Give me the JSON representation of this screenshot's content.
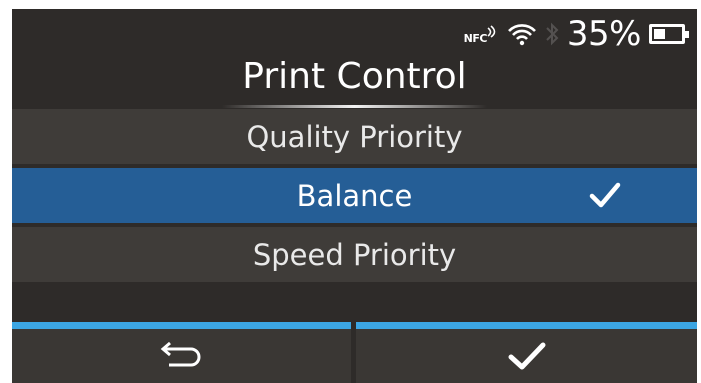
{
  "status_bar": {
    "nfc_label": "NFC",
    "wifi_icon": "wifi-icon",
    "bluetooth_icon": "bluetooth-icon",
    "battery_percent": "35%",
    "battery_level": 0.35
  },
  "screen": {
    "title": "Print Control"
  },
  "options": [
    {
      "label": "Quality Priority",
      "selected": false
    },
    {
      "label": "Balance",
      "selected": true
    },
    {
      "label": "Speed Priority",
      "selected": false
    }
  ],
  "footer": {
    "back_icon": "back-arrow-icon",
    "confirm_icon": "checkmark-icon"
  },
  "colors": {
    "background": "#2e2b29",
    "selected_row": "#255e96",
    "accent_line": "#3ca6e3"
  }
}
